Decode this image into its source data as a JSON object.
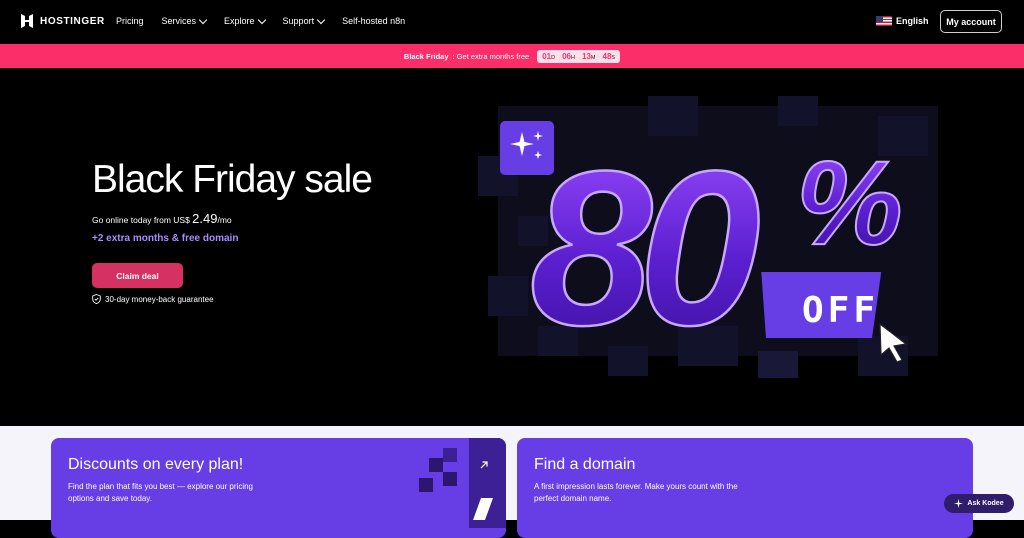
{
  "nav": {
    "logo_text": "HOSTINGER",
    "links": [
      {
        "label": "Pricing",
        "dropdown": false
      },
      {
        "label": "Services",
        "dropdown": true
      },
      {
        "label": "Explore",
        "dropdown": true
      },
      {
        "label": "Support",
        "dropdown": true
      },
      {
        "label": "Self-hosted n8n",
        "dropdown": false
      }
    ],
    "language": "English",
    "account_label": "My account"
  },
  "banner": {
    "bold": "Black Friday",
    "text": ": Get extra months free",
    "countdown": [
      {
        "value": "01",
        "unit": "D"
      },
      {
        "value": "06",
        "unit": "H"
      },
      {
        "value": "13",
        "unit": "M"
      },
      {
        "value": "48",
        "unit": "S"
      }
    ],
    "color": "#fc2e69"
  },
  "hero": {
    "title": "Black Friday sale",
    "sub_prefix": "Go online today from US$ ",
    "price": "2.49",
    "per": "/mo",
    "extra": "+2 extra months & free domain",
    "cta": "Claim deal",
    "guarantee": "30-day money-back guarantee",
    "promo_number": "80",
    "promo_percent": "%",
    "promo_off": "OFF"
  },
  "cards": [
    {
      "title": "Discounts on every plan!",
      "text": "Find the plan that fits you best — explore our pricing options and save today."
    },
    {
      "title": "Find a domain",
      "text": "A first impression lasts forever. Make yours count with the perfect domain name."
    }
  ],
  "chat": {
    "label": "Ask Kodee"
  },
  "colors": {
    "accent": "#673de6",
    "cta": "#d63163",
    "highlight": "#a98bff"
  }
}
